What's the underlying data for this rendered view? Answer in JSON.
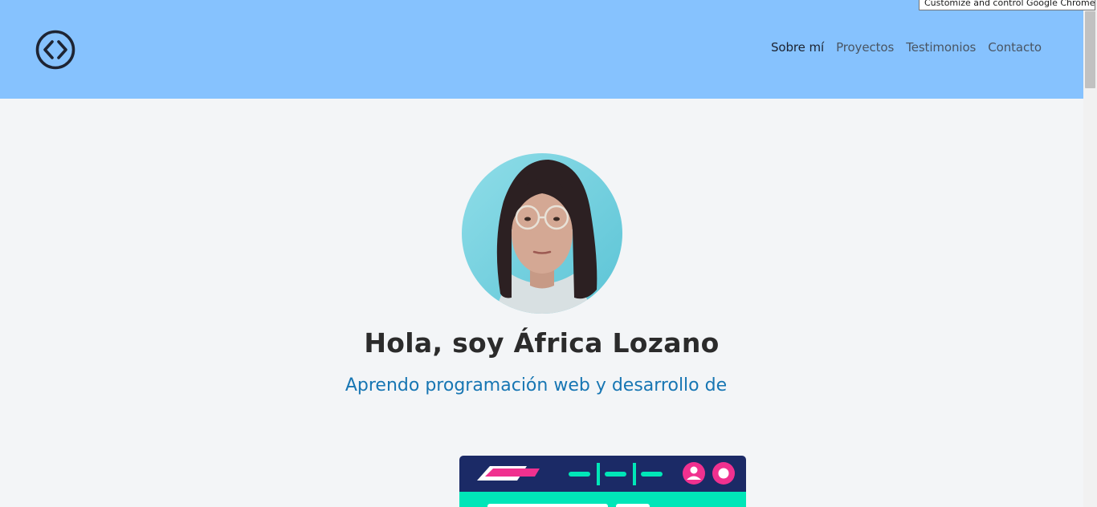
{
  "browser": {
    "tooltip": "Customize and control Google Chrome"
  },
  "navbar": {
    "logo_icon": "code-brackets-icon",
    "links": [
      {
        "label": "Sobre mí",
        "active": true
      },
      {
        "label": "Proyectos",
        "active": false
      },
      {
        "label": "Testimonios",
        "active": false
      },
      {
        "label": "Contacto",
        "active": false
      }
    ]
  },
  "hero": {
    "title": "Hola, soy África Lozano",
    "subtitle": "Aprendo programación web y desarrollo de"
  },
  "colors": {
    "navbar_bg": "#86c2fe",
    "page_bg": "#f3f5f7",
    "subtitle": "#1776b3",
    "preview_dark": "#1b2a66",
    "preview_mint": "#00e6b8",
    "preview_pink": "#f0318f"
  }
}
